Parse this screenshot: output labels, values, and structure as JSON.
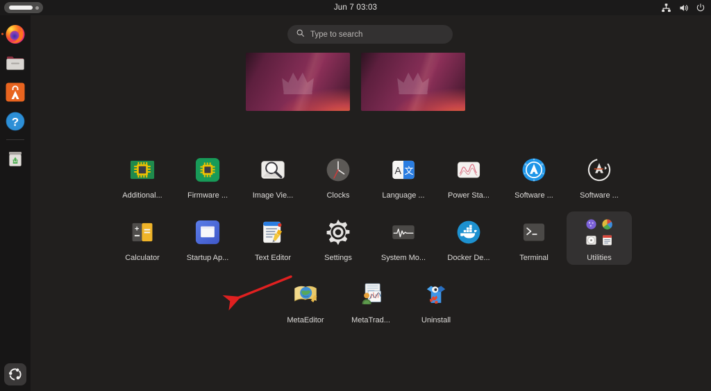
{
  "topbar": {
    "activities_label": "Activities",
    "clock": "Jun 7  03:03",
    "icons": [
      {
        "name": "network-icon",
        "label": "Network"
      },
      {
        "name": "volume-icon",
        "label": "Volume"
      },
      {
        "name": "power-icon",
        "label": "Power"
      }
    ]
  },
  "dock": {
    "items": [
      {
        "name": "firefox",
        "label": "Firefox",
        "running": true
      },
      {
        "name": "files",
        "label": "Files",
        "running": false
      },
      {
        "name": "ubuntu-software",
        "label": "Ubuntu Software",
        "running": false
      },
      {
        "name": "help",
        "label": "Help",
        "running": false
      },
      {
        "name": "trash",
        "label": "Trash",
        "running": false
      }
    ],
    "show_apps_label": "Show Applications"
  },
  "search": {
    "placeholder": "Type to search",
    "value": ""
  },
  "workspaces": {
    "count": 2,
    "items": [
      {
        "name": "workspace-1",
        "label": "Workspace 1"
      },
      {
        "name": "workspace-2",
        "label": "Workspace 2"
      }
    ]
  },
  "appgrid": {
    "rows": [
      [
        {
          "id": "additional-drivers",
          "label": "Additional...",
          "icon": "chip-board-icon"
        },
        {
          "id": "firmware-updater",
          "label": "Firmware ...",
          "icon": "chip-square-icon"
        },
        {
          "id": "image-viewer",
          "label": "Image Vie...",
          "icon": "magnifier-photo-icon"
        },
        {
          "id": "clocks",
          "label": "Clocks",
          "icon": "clock-icon"
        },
        {
          "id": "language-support",
          "label": "Language ...",
          "icon": "translate-icon"
        },
        {
          "id": "power-statistics",
          "label": "Power Sta...",
          "icon": "power-graph-icon"
        },
        {
          "id": "software",
          "label": "Software ...",
          "icon": "ubuntu-software-icon"
        },
        {
          "id": "software-updater",
          "label": "Software ...",
          "icon": "software-updater-icon"
        }
      ],
      [
        {
          "id": "calculator",
          "label": "Calculator",
          "icon": "calculator-icon"
        },
        {
          "id": "startup-applications",
          "label": "Startup Ap...",
          "icon": "startup-apps-icon"
        },
        {
          "id": "text-editor",
          "label": "Text Editor",
          "icon": "text-editor-icon"
        },
        {
          "id": "settings",
          "label": "Settings",
          "icon": "gear-icon"
        },
        {
          "id": "system-monitor",
          "label": "System Mo...",
          "icon": "system-monitor-icon"
        },
        {
          "id": "docker-desktop",
          "label": "Docker De...",
          "icon": "docker-whale-icon"
        },
        {
          "id": "terminal",
          "label": "Terminal",
          "icon": "terminal-icon"
        },
        {
          "id": "utilities",
          "label": "Utilities",
          "icon": "folder-utilities-icon",
          "folder": true
        }
      ],
      [
        {
          "id": "metaeditor",
          "label": "MetaEditor",
          "icon": "metaeditor-icon"
        },
        {
          "id": "metatrader",
          "label": "MetaTrad...",
          "icon": "metatrader-icon"
        },
        {
          "id": "uninstall",
          "label": "Uninstall",
          "icon": "uninstall-icon"
        }
      ]
    ]
  },
  "annotation": {
    "arrow": {
      "name": "red-pointer-arrow",
      "color": "#e02020",
      "target": "metatrader"
    }
  },
  "colors": {
    "desktop_bg": "#211f1e",
    "topbar_bg": "#1b1a1a",
    "dock_bg": "#171616",
    "accent": "#e95420",
    "search_bg": "#333131",
    "label_text": "#dedcda"
  }
}
